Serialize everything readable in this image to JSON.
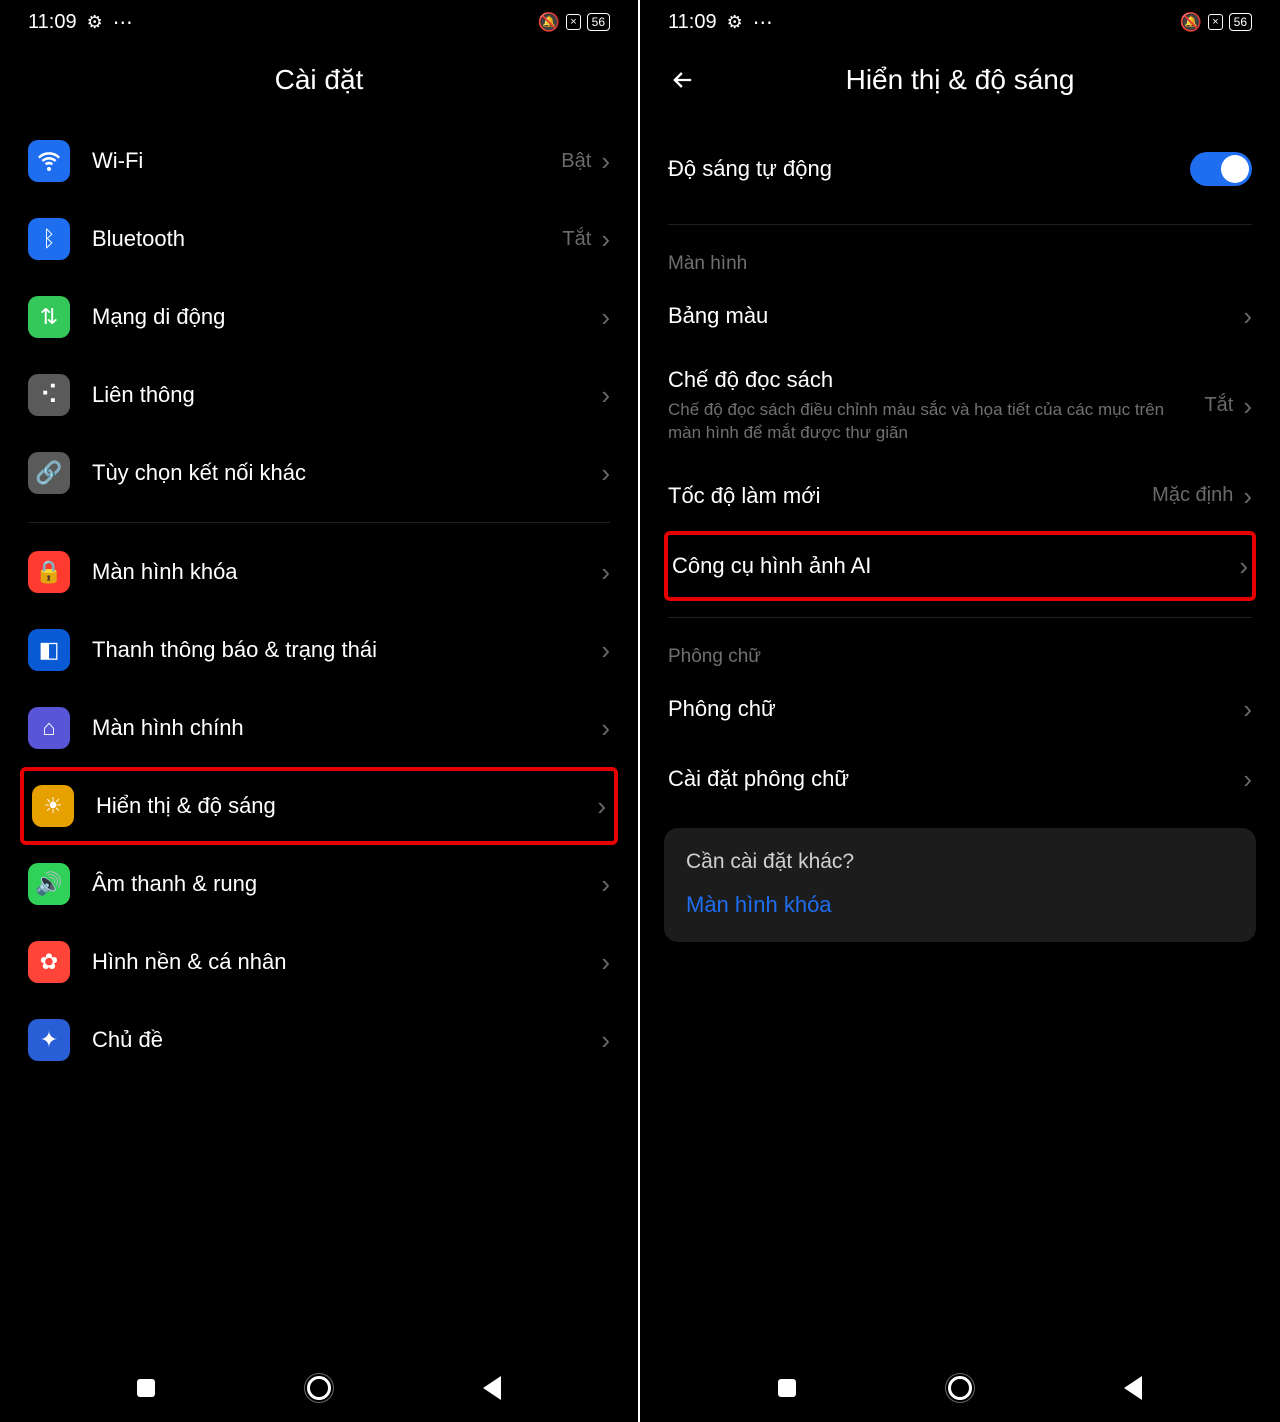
{
  "status": {
    "time": "11:09",
    "battery": "56"
  },
  "left": {
    "title": "Cài đặt",
    "groups": {
      "net": [
        {
          "key": "wifi",
          "label": "Wi-Fi",
          "value": "Bật",
          "icon": "wifi",
          "bg": "bg-blue"
        },
        {
          "key": "bluetooth",
          "label": "Bluetooth",
          "value": "Tắt",
          "icon": "bluetooth",
          "bg": "bg-blue"
        },
        {
          "key": "mobile-data",
          "label": "Mạng di động",
          "value": "",
          "icon": "arrows",
          "bg": "bg-green"
        },
        {
          "key": "interconnect",
          "label": "Liên thông",
          "value": "",
          "icon": "dots",
          "bg": "bg-grey"
        },
        {
          "key": "more-conn",
          "label": "Tùy chọn kết nối khác",
          "value": "",
          "icon": "link",
          "bg": "bg-grey"
        }
      ],
      "sys": [
        {
          "key": "lockscreen",
          "label": "Màn hình khóa",
          "value": "",
          "icon": "lock",
          "bg": "bg-orange",
          "hl": false
        },
        {
          "key": "statusbar",
          "label": "Thanh thông báo & trạng thái",
          "value": "",
          "icon": "square",
          "bg": "bg-blue2",
          "hl": false
        },
        {
          "key": "home",
          "label": "Màn hình chính",
          "value": "",
          "icon": "home",
          "bg": "bg-purple",
          "hl": false
        },
        {
          "key": "display",
          "label": "Hiển thị & độ sáng",
          "value": "",
          "icon": "sun",
          "bg": "bg-yellow",
          "hl": true
        },
        {
          "key": "sound",
          "label": "Âm thanh & rung",
          "value": "",
          "icon": "speaker",
          "bg": "bg-green2",
          "hl": false
        },
        {
          "key": "wallpaper",
          "label": "Hình nền & cá nhân",
          "value": "",
          "icon": "flower",
          "bg": "bg-red2",
          "hl": false
        },
        {
          "key": "theme",
          "label": "Chủ đề",
          "value": "",
          "icon": "wand",
          "bg": "bg-blue3",
          "hl": false
        }
      ]
    }
  },
  "right": {
    "title": "Hiển thị & độ sáng",
    "auto_brightness": {
      "label": "Độ sáng tự động",
      "on": true
    },
    "sections": {
      "screen_head": "Màn hình",
      "color": {
        "label": "Bảng màu"
      },
      "reading": {
        "label": "Chế độ đọc sách",
        "desc": "Chế độ đọc sách điều chỉnh màu sắc và họa tiết của các mục trên màn hình để mắt được thư giãn",
        "value": "Tắt"
      },
      "refresh": {
        "label": "Tốc độ làm mới",
        "value": "Mặc định"
      },
      "ai_image": {
        "label": "Công cụ hình ảnh AI",
        "hl": true
      },
      "font_head": "Phông chữ",
      "font": {
        "label": "Phông chữ"
      },
      "font_settings": {
        "label": "Cài đặt phông chữ"
      }
    },
    "card": {
      "title": "Cần cài đặt khác?",
      "link": "Màn hình khóa"
    }
  }
}
